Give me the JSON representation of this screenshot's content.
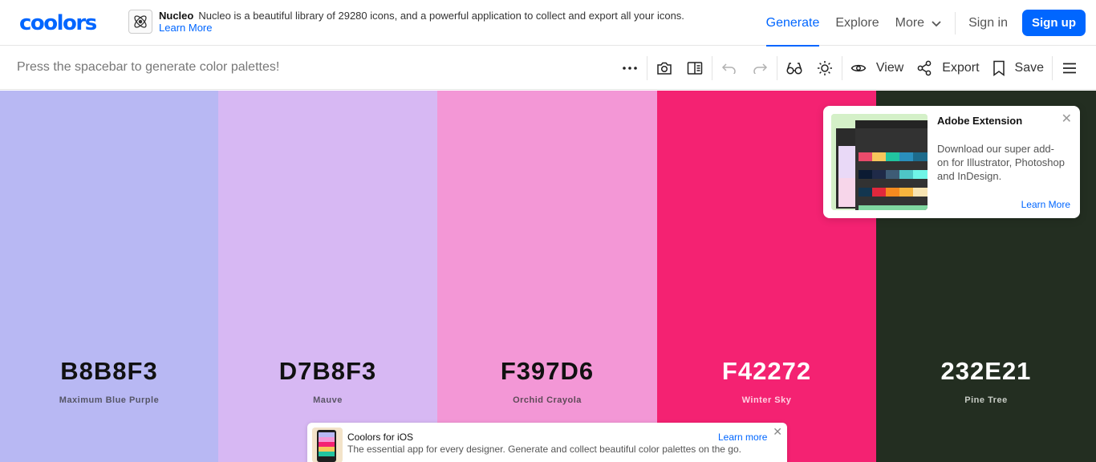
{
  "nav": {
    "logo": "coolors",
    "ad": {
      "title": "Nucleo",
      "text": "Nucleo is a beautiful library of 29280 icons, and a powerful application to collect and export all your icons.",
      "link": "Learn More"
    },
    "links": {
      "generate": "Generate",
      "explore": "Explore",
      "more": "More",
      "signin": "Sign in",
      "signup": "Sign up"
    }
  },
  "toolbar": {
    "hint": "Press the spacebar to generate color palettes!",
    "view": "View",
    "export": "Export",
    "save": "Save"
  },
  "palette": [
    {
      "hex": "B8B8F3",
      "name": "Maximum Blue Purple",
      "bg": "#B8B8F3",
      "text_color": "#111111",
      "name_color": "#555566"
    },
    {
      "hex": "D7B8F3",
      "name": "Mauve",
      "bg": "#D7B8F3",
      "text_color": "#111111",
      "name_color": "#5a5566"
    },
    {
      "hex": "F397D6",
      "name": "Orchid Crayola",
      "bg": "#F397D6",
      "text_color": "#111111",
      "name_color": "#5e4a58"
    },
    {
      "hex": "F42272",
      "name": "Winter Sky",
      "bg": "#F42272",
      "text_color": "#ffffff",
      "name_color": "#ffd0e2"
    },
    {
      "hex": "232E21",
      "name": "Pine Tree",
      "bg": "#232E21",
      "text_color": "#ffffff",
      "name_color": "#c7ccc5"
    }
  ],
  "adobe_popup": {
    "title": "Adobe Extension",
    "body": "Download our super add-on for Illustrator, Photoshop and InDesign.",
    "link": "Learn More"
  },
  "ios_banner": {
    "title": "Coolors for iOS",
    "body": "The essential app for every designer. Generate and collect beautiful color palettes on the go.",
    "link": "Learn more"
  },
  "colors": {
    "accent": "#0066ff"
  }
}
